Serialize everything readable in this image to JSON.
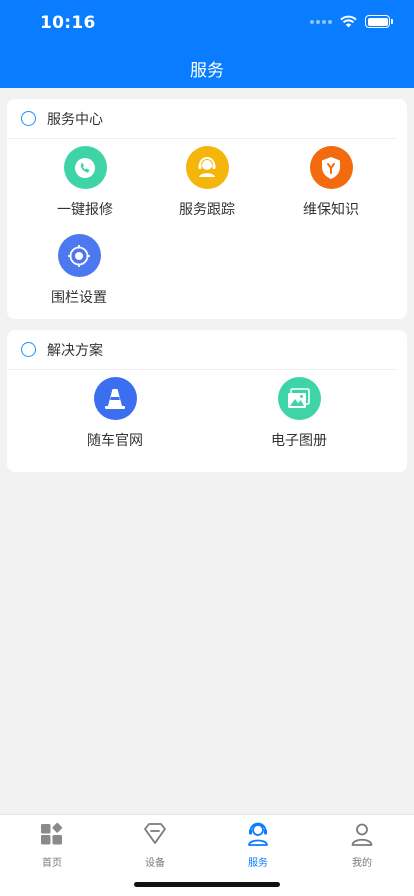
{
  "status_bar": {
    "time": "10:16"
  },
  "nav": {
    "title": "服务"
  },
  "service_center": {
    "title": "服务中心",
    "items": [
      {
        "label": "一键报修",
        "icon": "phone-icon",
        "color": "#3fd4a8"
      },
      {
        "label": "服务跟踪",
        "icon": "headset-agent-icon",
        "color": "#f5b50a"
      },
      {
        "label": "维保知识",
        "icon": "shield-wrench-icon",
        "color": "#f26b0f"
      },
      {
        "label": "围栏设置",
        "icon": "location-target-icon",
        "color": "#4c78f0"
      }
    ]
  },
  "solutions": {
    "title": "解决方案",
    "items": [
      {
        "label": "随车官网",
        "icon": "traffic-cone-icon",
        "color": "#3b6ff0"
      },
      {
        "label": "电子图册",
        "icon": "image-album-icon",
        "color": "#3fd4a8"
      }
    ]
  },
  "tabs": [
    {
      "label": "首页",
      "icon": "home-grid-icon",
      "active": false
    },
    {
      "label": "设备",
      "icon": "device-icon",
      "active": false
    },
    {
      "label": "服务",
      "icon": "service-agent-icon",
      "active": true
    },
    {
      "label": "我的",
      "icon": "profile-icon",
      "active": false
    }
  ],
  "colors": {
    "primary": "#0a7cff",
    "background": "#f2f2f2"
  }
}
